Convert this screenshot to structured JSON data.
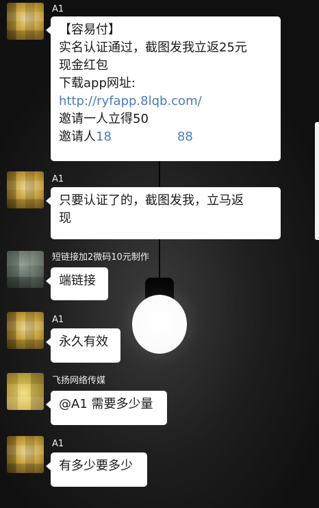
{
  "messages": [
    {
      "sender": "A1",
      "lines": [
        "【容易付】",
        "实名认证通过，截图发我立返25元",
        "现金红包",
        "下载app网址:",
        "http://ryfapp.8lqb.com/",
        "邀请一人立得50"
      ],
      "invite_prefix": "邀请人",
      "invite_visible_start": "18",
      "invite_visible_end": "88"
    },
    {
      "sender": "A1",
      "lines": [
        "只要认证了的，截图发我，立马返",
        "现"
      ]
    },
    {
      "sender": "短链接加2微码10元制作",
      "lines": [
        "端链接"
      ]
    },
    {
      "sender": "A1",
      "lines": [
        "永久有效"
      ]
    },
    {
      "sender": "飞扬网络传媒",
      "lines": [
        "@A1 需要多少量"
      ]
    },
    {
      "sender": "A1",
      "lines": [
        "有多少要多少"
      ]
    }
  ],
  "colors": {
    "bubble": "#ffffff",
    "link": "#4a7bb8",
    "sender_text": "#ededed",
    "background": "#1e1e1e"
  }
}
